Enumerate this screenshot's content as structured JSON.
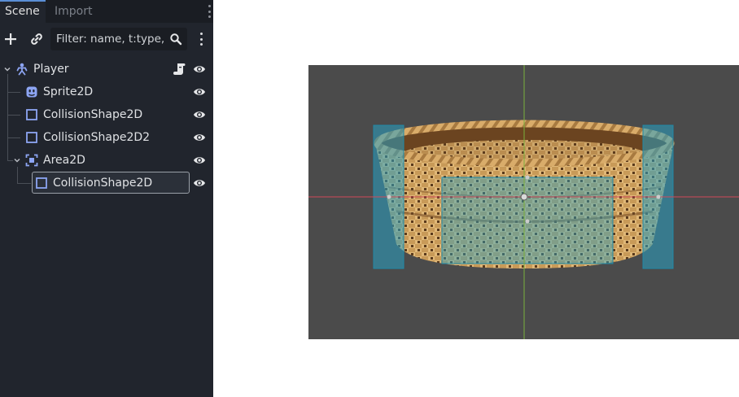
{
  "dock": {
    "tabs": [
      {
        "label": "Scene",
        "active": true
      },
      {
        "label": "Import",
        "active": false
      }
    ],
    "toolbar": {
      "add_icon": "plus-icon",
      "link_icon": "link-icon",
      "filter_placeholder": "Filter: name, t:type,",
      "search_icon": "search-icon",
      "menu_icon": "kebab-menu-icon"
    },
    "tree": [
      {
        "label": "Player",
        "type_icon": "character-body-2d-icon",
        "expanded": true,
        "has_script": true,
        "visible": true
      },
      {
        "label": "Sprite2D",
        "type_icon": "sprite-2d-icon",
        "visible": true
      },
      {
        "label": "CollisionShape2D",
        "type_icon": "collision-shape-2d-icon",
        "visible": true
      },
      {
        "label": "CollisionShape2D2",
        "type_icon": "collision-shape-2d-icon",
        "visible": true
      },
      {
        "label": "Area2D",
        "type_icon": "area-2d-icon",
        "expanded": true,
        "visible": true
      },
      {
        "label": "CollisionShape2D",
        "type_icon": "collision-shape-2d-icon",
        "visible": true,
        "selected": true
      }
    ]
  },
  "viewport": {
    "background_color": "#4b4b4b",
    "x_axis_color": "#d04a5a",
    "y_axis_color": "#7ab03c",
    "collision_color": "#2aa3c4",
    "sprite_description_icon": "woven-basket-sprite"
  },
  "colors": {
    "dock_bg": "#21252d",
    "accent": "#5a8fd6",
    "node_icon_blue": "#8da5f3"
  }
}
